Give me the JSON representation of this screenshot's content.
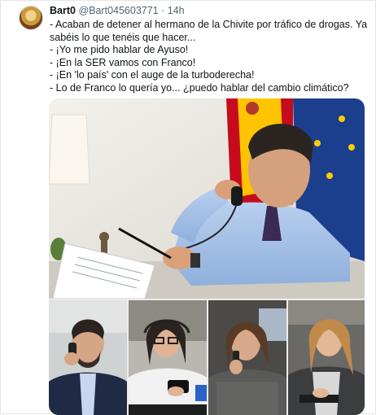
{
  "tweet": {
    "author_name": "Bart0",
    "handle": "@Bart045603771",
    "separator": "·",
    "time": "14h",
    "lines": [
      "- Acaban de detener al hermano de la Chivite por tráfico de drogas. Ya",
      "sabéis lo que tenéis que hacer...",
      "- ¡Yo me pido hablar de Ayuso!",
      "- ¡En la SER vamos con Franco!",
      "- ¡En 'lo país' con el auge de la turboderecha!",
      "- Lo de Franco lo quería yo... ¿puedo hablar del cambio climático?"
    ]
  },
  "colors": {
    "text_primary": "#0f1419",
    "text_secondary": "#536471",
    "flag_red": "#c60b1e",
    "flag_yellow": "#ffc400",
    "eu_blue": "#1b3f8c",
    "shirt_blue": "#a9c3e6"
  },
  "icons": {
    "avatar": "profile-picture"
  }
}
